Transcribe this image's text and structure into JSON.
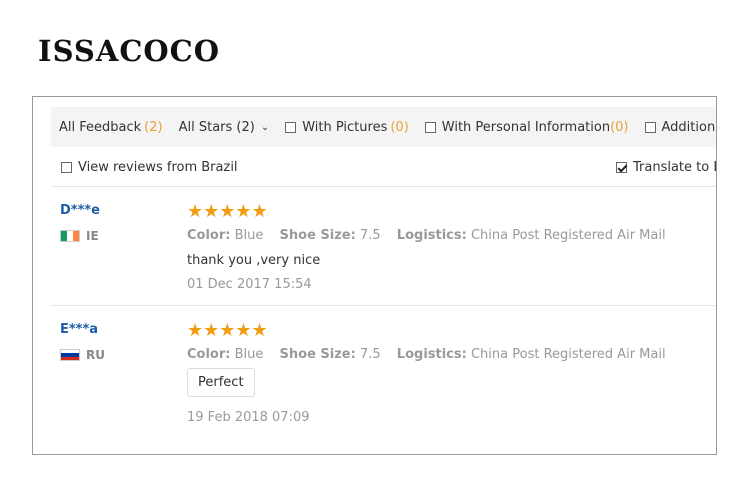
{
  "brand": "ISSACOCO",
  "filters": {
    "all_feedback": {
      "label": "All Feedback",
      "count": "(2)"
    },
    "all_stars": {
      "label": "All Stars (2)"
    },
    "with_pictures": {
      "label": "With Pictures",
      "count": "(0)"
    },
    "with_personal_info": {
      "label": "With Personal Information",
      "count": "(0)"
    },
    "additional": {
      "label": "Additional F"
    }
  },
  "options": {
    "view_brazil": {
      "label": "View reviews from Brazil",
      "checked": false
    },
    "translate": {
      "label": "Translate to E",
      "checked": true
    }
  },
  "attr_labels": {
    "color": "Color:",
    "shoe_size": "Shoe Size:",
    "logistics": "Logistics:"
  },
  "reviews": [
    {
      "user": "D***e",
      "country": "IE",
      "stars": "★★★★★",
      "rating": 5,
      "color": "Blue",
      "shoe_size": "7.5",
      "logistics": "China Post Registered Air Mail",
      "comment": "thank you ,very nice",
      "date": "01 Dec 2017 15:54"
    },
    {
      "user": "E***a",
      "country": "RU",
      "stars": "★★★★★",
      "rating": 5,
      "color": "Blue",
      "shoe_size": "7.5",
      "logistics": "China Post Registered Air Mail",
      "comment": "Perfect",
      "date": "19 Feb 2018 07:09"
    }
  ],
  "colors": {
    "star": "#f39c12",
    "username": "#1c5ea8",
    "count": "#e8a33a"
  }
}
